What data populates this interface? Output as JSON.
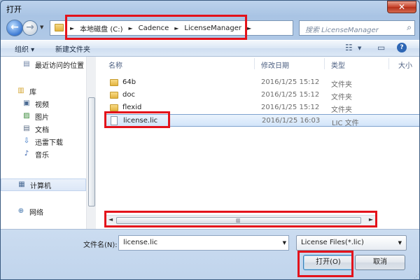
{
  "window": {
    "title": "打开",
    "close_glyph": "✕"
  },
  "address": {
    "crumbs": [
      "本地磁盘 (C:)",
      "Cadence",
      "LicenseManager"
    ],
    "search_placeholder": "搜索 LicenseManager"
  },
  "toolbar": {
    "organize": "组织 ▾",
    "new_folder": "新建文件夹"
  },
  "nav": {
    "items": [
      {
        "label": "最近访问的位置",
        "icon": "recent-places-icon"
      },
      {
        "label": "库",
        "icon": "library-icon"
      },
      {
        "label": "视频",
        "icon": "video-icon"
      },
      {
        "label": "图片",
        "icon": "picture-icon"
      },
      {
        "label": "文档",
        "icon": "document-icon"
      },
      {
        "label": "迅雷下载",
        "icon": "thunder-download-icon"
      },
      {
        "label": "音乐",
        "icon": "music-icon"
      },
      {
        "label": "计算机",
        "icon": "computer-icon"
      },
      {
        "label": "网络",
        "icon": "network-icon"
      }
    ]
  },
  "columns": {
    "name": "名称",
    "modified": "修改日期",
    "type": "类型",
    "size": "大小"
  },
  "files": [
    {
      "name": "64b",
      "modified": "2016/1/25 15:12",
      "type": "文件夹",
      "kind": "folder"
    },
    {
      "name": "doc",
      "modified": "2016/1/25 15:12",
      "type": "文件夹",
      "kind": "folder"
    },
    {
      "name": "flexid",
      "modified": "2016/1/25 15:12",
      "type": "文件夹",
      "kind": "folder"
    },
    {
      "name": "license.lic",
      "modified": "2016/1/25 16:03",
      "type": "LIC 文件",
      "kind": "file",
      "selected": true
    }
  ],
  "bottom": {
    "filename_label": "文件名(N):",
    "filename_value": "license.lic",
    "filetype_value": "License Files(*.lic)",
    "open_label": "打开(O)",
    "cancel_label": "取消"
  },
  "colors": {
    "highlight_box": "#e3121b",
    "window_chrome": "#b9cfea"
  }
}
